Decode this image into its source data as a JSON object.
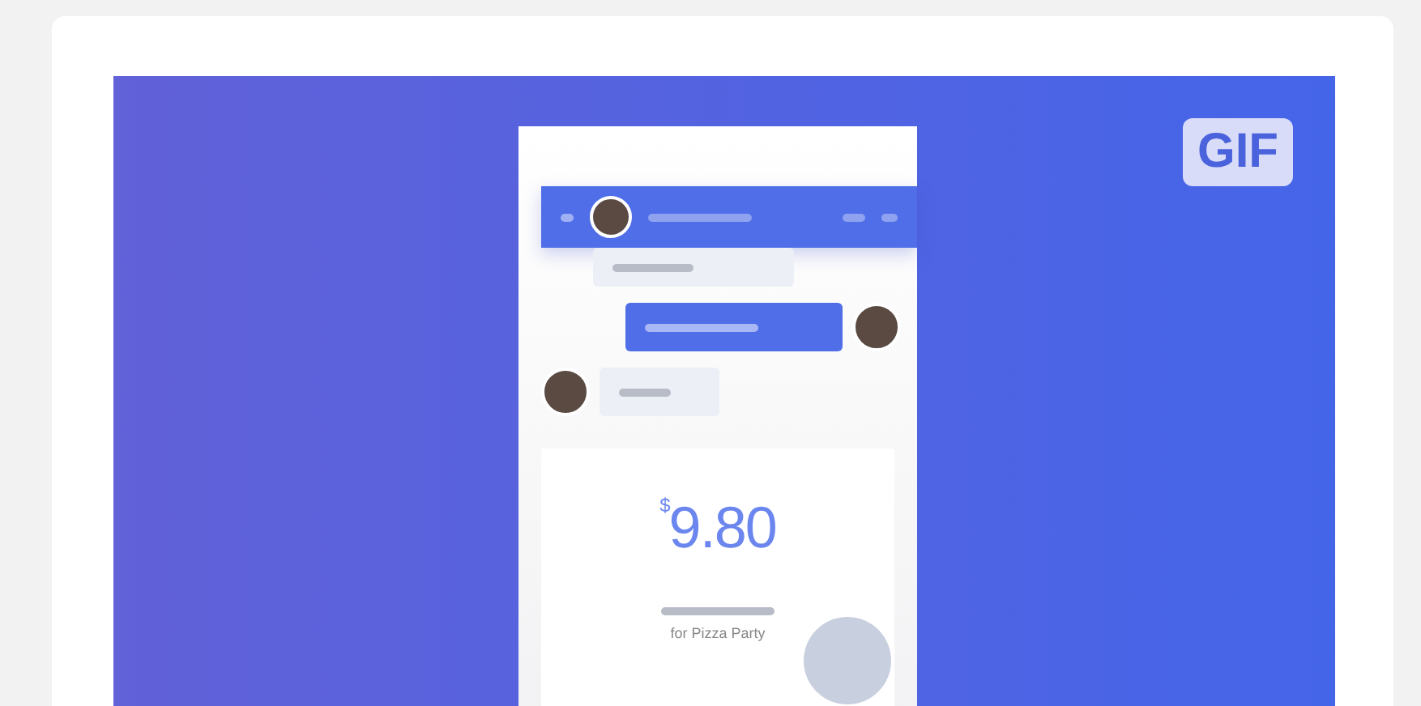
{
  "badge": "GIF",
  "payment": {
    "currency": "$",
    "amount": "9.80",
    "note": "for Pizza Party"
  }
}
